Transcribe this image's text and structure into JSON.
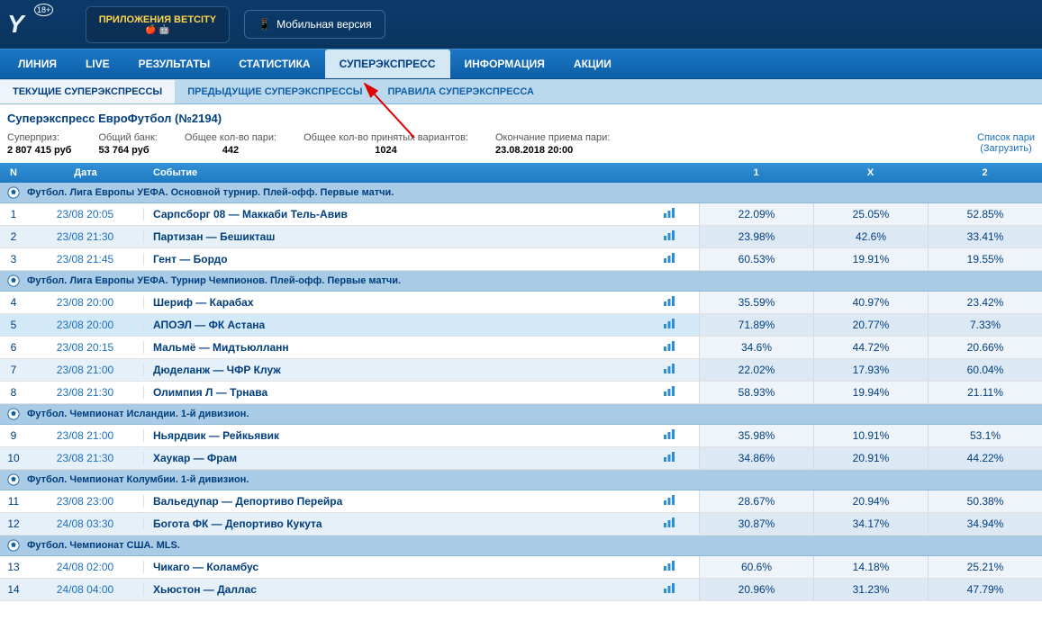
{
  "top": {
    "app_btn": "ПРИЛОЖЕНИЯ BETCITY",
    "mobile_btn": "Мобильная версия",
    "age": "18+"
  },
  "nav": [
    "ЛИНИЯ",
    "LIVE",
    "РЕЗУЛЬТАТЫ",
    "СТАТИСТИКА",
    "СУПЕРЭКСПРЕСС",
    "ИНФОРМАЦИЯ",
    "АКЦИИ"
  ],
  "sub_tabs": [
    "ТЕКУЩИЕ СУПЕРЭКСПРЕССЫ",
    "ПРЕДЫДУЩИЕ СУПЕРЭКСПРЕССЫ",
    "ПРАВИЛА СУПЕРЭКСПРЕССА"
  ],
  "title": "Суперэкспресс ЕвроФутбол (№2194)",
  "stats": {
    "superprize_label": "Суперприз:",
    "superprize_value": "2 807 415 руб",
    "bank_label": "Общий банк:",
    "bank_value": "53 764 руб",
    "bets_label": "Общее кол-во пари:",
    "bets_value": "442",
    "variants_label": "Общее кол-во принятых вариантов:",
    "variants_value": "1024",
    "deadline_label": "Окончание приема пари:",
    "deadline_value": "23.08.2018 20:00",
    "list_link": "Список пари",
    "download_link": "(Загрузить)"
  },
  "headers": {
    "n": "N",
    "date": "Дата",
    "event": "Событие",
    "c1": "1",
    "cx": "X",
    "c2": "2"
  },
  "groups": [
    {
      "title": "Футбол. Лига Европы УЕФА. Основной турнир. Плей-офф. Первые матчи.",
      "rows": [
        {
          "n": "1",
          "date": "23/08 20:05",
          "event": "Сарпсборг 08 — Маккаби Тель-Авив",
          "c1": "22.09%",
          "cx": "25.05%",
          "c2": "52.85%"
        },
        {
          "n": "2",
          "date": "23/08 21:30",
          "event": "Партизан — Бешикташ",
          "c1": "23.98%",
          "cx": "42.6%",
          "c2": "33.41%"
        },
        {
          "n": "3",
          "date": "23/08 21:45",
          "event": "Гент — Бордо",
          "c1": "60.53%",
          "cx": "19.91%",
          "c2": "19.55%"
        }
      ]
    },
    {
      "title": "Футбол. Лига Европы УЕФА. Турнир Чемпионов. Плей-офф. Первые матчи.",
      "rows": [
        {
          "n": "4",
          "date": "23/08 20:00",
          "event": "Шериф — Карабах",
          "c1": "35.59%",
          "cx": "40.97%",
          "c2": "23.42%"
        },
        {
          "n": "5",
          "date": "23/08 20:00",
          "event": "АПОЭЛ — ФК Астана",
          "c1": "71.89%",
          "cx": "20.77%",
          "c2": "7.33%",
          "sel": true
        },
        {
          "n": "6",
          "date": "23/08 20:15",
          "event": "Мальмё — Мидтьюлланн",
          "c1": "34.6%",
          "cx": "44.72%",
          "c2": "20.66%"
        },
        {
          "n": "7",
          "date": "23/08 21:00",
          "event": "Дюделанж — ЧФР Клуж",
          "c1": "22.02%",
          "cx": "17.93%",
          "c2": "60.04%"
        },
        {
          "n": "8",
          "date": "23/08 21:30",
          "event": "Олимпия Л — Трнава",
          "c1": "58.93%",
          "cx": "19.94%",
          "c2": "21.11%"
        }
      ]
    },
    {
      "title": "Футбол. Чемпионат Исландии. 1-й дивизион.",
      "rows": [
        {
          "n": "9",
          "date": "23/08 21:00",
          "event": "Ньярдвик — Рейкьявик",
          "c1": "35.98%",
          "cx": "10.91%",
          "c2": "53.1%"
        },
        {
          "n": "10",
          "date": "23/08 21:30",
          "event": "Хаукар — Фрам",
          "c1": "34.86%",
          "cx": "20.91%",
          "c2": "44.22%"
        }
      ]
    },
    {
      "title": "Футбол. Чемпионат Колумбии. 1-й дивизион.",
      "rows": [
        {
          "n": "11",
          "date": "23/08 23:00",
          "event": "Вальедупар — Депортиво Перейра",
          "c1": "28.67%",
          "cx": "20.94%",
          "c2": "50.38%"
        },
        {
          "n": "12",
          "date": "24/08 03:30",
          "event": "Богота ФК — Депортиво Кукута",
          "c1": "30.87%",
          "cx": "34.17%",
          "c2": "34.94%"
        }
      ]
    },
    {
      "title": "Футбол. Чемпионат США. MLS.",
      "rows": [
        {
          "n": "13",
          "date": "24/08 02:00",
          "event": "Чикаго — Коламбус",
          "c1": "60.6%",
          "cx": "14.18%",
          "c2": "25.21%"
        },
        {
          "n": "14",
          "date": "24/08 04:00",
          "event": "Хьюстон — Даллас",
          "c1": "20.96%",
          "cx": "31.23%",
          "c2": "47.79%"
        }
      ]
    }
  ]
}
